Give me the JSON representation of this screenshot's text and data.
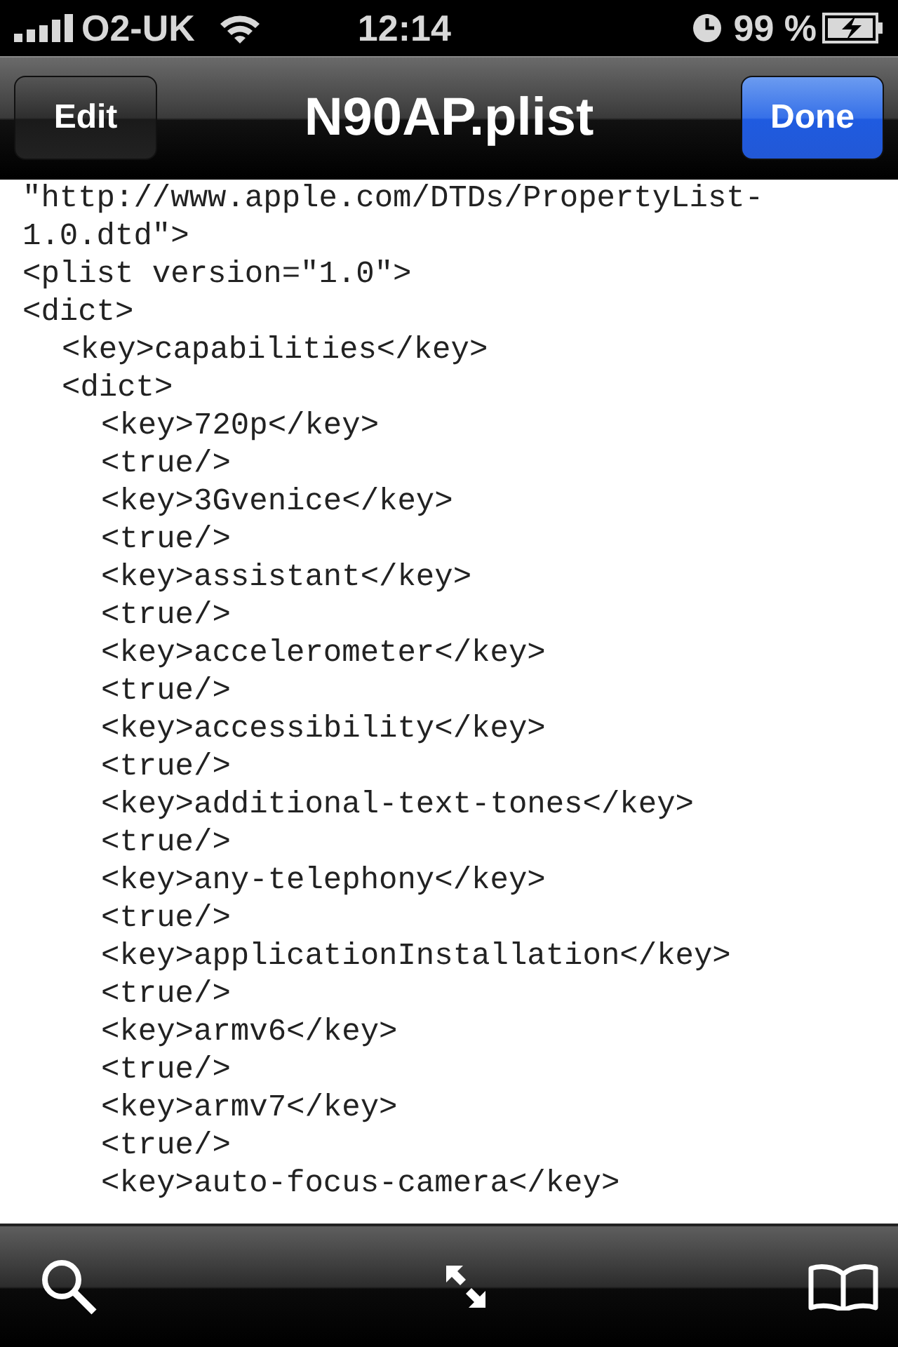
{
  "status_bar": {
    "carrier": "O2-UK",
    "time": "12:14",
    "battery": "99 %"
  },
  "nav_bar": {
    "left_button": "Edit",
    "title": "N90AP.plist",
    "right_button": "Done"
  },
  "document": {
    "lines": [
      {
        "text": "\"http://www.apple.com/DTDs/PropertyList-"
      },
      {
        "text": "1.0.dtd\">"
      },
      {
        "text": "<plist version=\"1.0\">"
      },
      {
        "text": "<dict>",
        "children": [
          {
            "text": "<key>capabilities</key>"
          },
          {
            "text": "<dict>",
            "children": [
              {
                "text": "<key>720p</key>"
              },
              {
                "text": "<true/>"
              },
              {
                "text": "<key>3Gvenice</key>"
              },
              {
                "text": "<true/>"
              },
              {
                "text": "<key>assistant</key>"
              },
              {
                "text": "<true/>"
              },
              {
                "text": "<key>accelerometer</key>"
              },
              {
                "text": "<true/>"
              },
              {
                "text": "<key>accessibility</key>"
              },
              {
                "text": "<true/>"
              },
              {
                "text": "<key>additional-text-tones</key>"
              },
              {
                "text": "<true/>"
              },
              {
                "text": "<key>any-telephony</key>"
              },
              {
                "text": "<true/>"
              },
              {
                "text": "<key>applicationInstallation</key>"
              },
              {
                "text": "<true/>"
              },
              {
                "text": "<key>armv6</key>"
              },
              {
                "text": "<true/>"
              },
              {
                "text": "<key>armv7</key>"
              },
              {
                "text": "<true/>"
              },
              {
                "text": "<key>auto-focus-camera</key>"
              }
            ]
          }
        ]
      }
    ]
  }
}
